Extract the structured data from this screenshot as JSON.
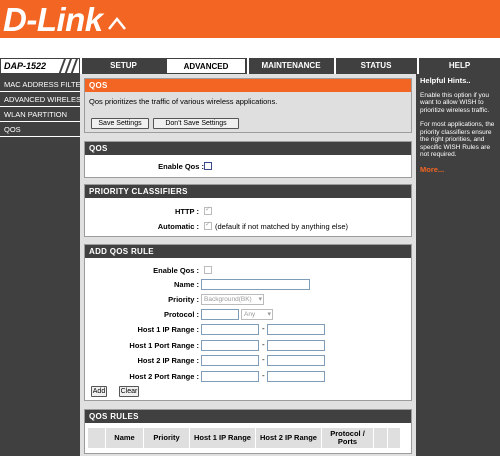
{
  "brand": {
    "logo_text": "D-Link",
    "model": "DAP-1522",
    "accent": "#f26522"
  },
  "nav": {
    "tabs": [
      {
        "label": "SETUP"
      },
      {
        "label": "ADVANCED"
      },
      {
        "label": "MAINTENANCE"
      },
      {
        "label": "STATUS"
      },
      {
        "label": "HELP"
      }
    ],
    "active_tab": "ADVANCED"
  },
  "sidebar": {
    "items": [
      {
        "label": "MAC ADDRESS FILTER"
      },
      {
        "label": "ADVANCED WIRELESS"
      },
      {
        "label": "WLAN PARTITION"
      },
      {
        "label": "QOS"
      }
    ],
    "active_item": "QOS"
  },
  "intro": {
    "title": "QOS",
    "description": "Qos prioritizes the traffic of various wireless applications.",
    "save_label": "Save Settings",
    "dont_save_label": "Don't Save Settings"
  },
  "qos": {
    "title": "QOS",
    "enable_label": "Enable Qos :"
  },
  "classifiers": {
    "title": "PRIORITY CLASSIFIERS",
    "http_label": "HTTP :",
    "automatic_label": "Automatic :",
    "automatic_note": "(default if not matched by anything else)"
  },
  "add_rule": {
    "title": "ADD QOS RULE",
    "enable_label": "Enable Qos :",
    "name_label": "Name :",
    "priority_label": "Priority :",
    "priority_value": "Background(BK)",
    "protocol_label": "Protocol :",
    "protocol_value": "Any",
    "host1_ip_label": "Host 1 IP Range :",
    "host1_port_label": "Host 1 Port Range :",
    "host2_ip_label": "Host 2 IP Range :",
    "host2_port_label": "Host 2 Port Range :",
    "range_sep": "-",
    "add_label": "Add",
    "clear_label": "Clear"
  },
  "rules": {
    "title": "QOS RULES",
    "columns": [
      "Name",
      "Priority",
      "Host 1 IP Range",
      "Host 2 IP Range",
      "Protocol / Ports"
    ]
  },
  "hints": {
    "title": "Helpful Hints..",
    "p1": "Enable this option if you want to allow WISH to prioritize wireless traffic.",
    "p2": "For most applications, the priority classifiers ensure the right priorities, and specific WISH Rules are not required.",
    "more": "More..."
  }
}
